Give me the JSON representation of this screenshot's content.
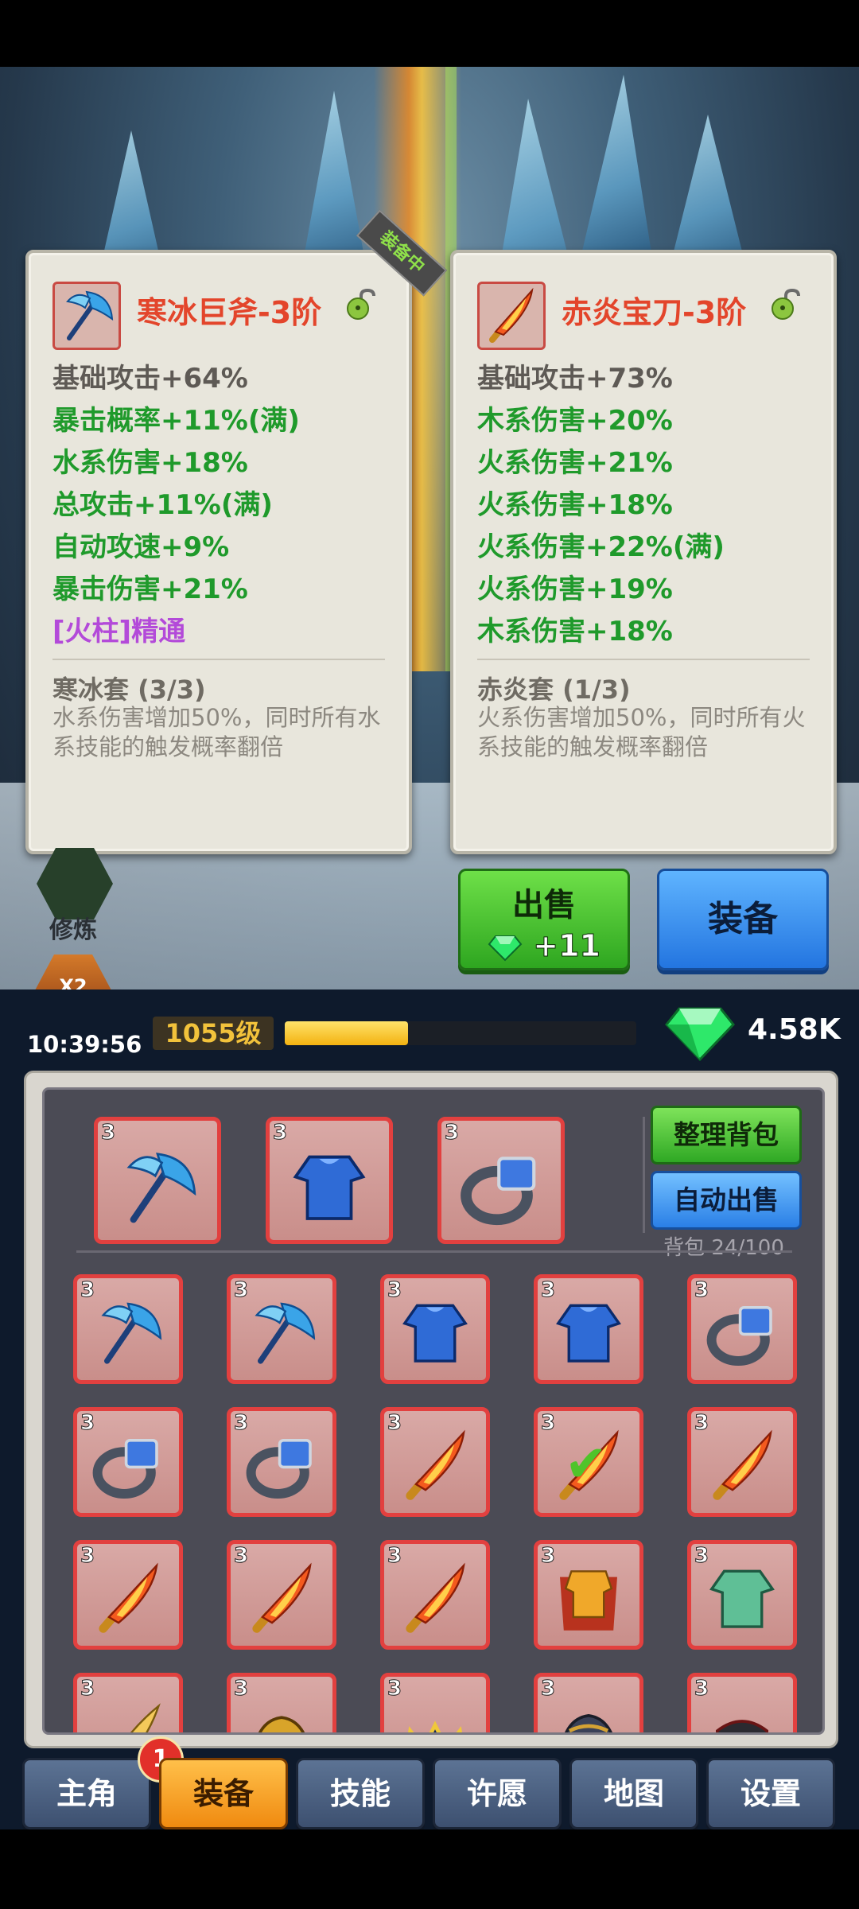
{
  "left_card": {
    "name": "寒冰巨斧-3阶",
    "equipped_tag": "装备中",
    "stats": [
      {
        "text": "基础攻击+64%",
        "color": "base"
      },
      {
        "text": "暴击概率+11%(满)",
        "color": "green"
      },
      {
        "text": "水系伤害+18%",
        "color": "green"
      },
      {
        "text": "总攻击+11%(满)",
        "color": "green"
      },
      {
        "text": "自动攻速+9%",
        "color": "green"
      },
      {
        "text": "暴击伤害+21%",
        "color": "green"
      },
      {
        "text": "[火柱]精通",
        "color": "purple"
      }
    ],
    "set_name": "寒冰套 (3/3)",
    "set_desc": "水系伤害增加50%，同时所有水系技能的触发概率翻倍"
  },
  "right_card": {
    "name": "赤炎宝刀-3阶",
    "stats": [
      {
        "text": "基础攻击+73%",
        "color": "base"
      },
      {
        "text": "木系伤害+20%",
        "color": "green"
      },
      {
        "text": "火系伤害+21%",
        "color": "green"
      },
      {
        "text": "火系伤害+18%",
        "color": "green"
      },
      {
        "text": "火系伤害+22%(满)",
        "color": "green"
      },
      {
        "text": "火系伤害+19%",
        "color": "green"
      },
      {
        "text": "木系伤害+18%",
        "color": "green"
      }
    ],
    "set_name": "赤炎套 (1/3)",
    "set_desc": "火系伤害增加50%，同时所有火系技能的触发概率翻倍"
  },
  "actions": {
    "sell_label": "出售",
    "sell_value": "+11",
    "equip_label": "装备"
  },
  "hud": {
    "cultivate_label": "修炼",
    "multiplier": "X2",
    "time": "10:39:56",
    "level": "1055级",
    "exp_fraction": 0.35,
    "gems": "4.58K"
  },
  "inventory": {
    "sort_label": "整理背包",
    "auto_sell_label": "自动出售",
    "bag_count": "背包 24/100",
    "equipped": [
      {
        "level": "3",
        "type": "axe"
      },
      {
        "level": "3",
        "type": "armor"
      },
      {
        "level": "3",
        "type": "ring"
      }
    ],
    "items": [
      {
        "level": "3",
        "type": "axe"
      },
      {
        "level": "3",
        "type": "axe"
      },
      {
        "level": "3",
        "type": "armor"
      },
      {
        "level": "3",
        "type": "armor"
      },
      {
        "level": "3",
        "type": "ring"
      },
      {
        "level": "3",
        "type": "ring"
      },
      {
        "level": "3",
        "type": "ring"
      },
      {
        "level": "3",
        "type": "sword"
      },
      {
        "level": "3",
        "type": "sword",
        "checked": true
      },
      {
        "level": "3",
        "type": "sword"
      },
      {
        "level": "3",
        "type": "sword"
      },
      {
        "level": "3",
        "type": "sword"
      },
      {
        "level": "3",
        "type": "sword"
      },
      {
        "level": "3",
        "type": "cape-armor"
      },
      {
        "level": "3",
        "type": "jade-armor"
      },
      {
        "level": "3",
        "type": "blade"
      },
      {
        "level": "3",
        "type": "helmet"
      },
      {
        "level": "3",
        "type": "crown"
      },
      {
        "level": "3",
        "type": "dark-helmet"
      },
      {
        "level": "3",
        "type": "dark-armor"
      }
    ]
  },
  "tabs": {
    "hero": "主角",
    "hero_badge": "1",
    "equipment": "装备",
    "skills": "技能",
    "wish": "许愿",
    "map": "地图",
    "settings": "设置"
  },
  "colors": {
    "stat_base": "#5e5a55",
    "stat_green": "#1f9a2b",
    "stat_purple": "#b34ad9",
    "item_name_red": "#e3452b",
    "slot_border": "#e2403f"
  }
}
